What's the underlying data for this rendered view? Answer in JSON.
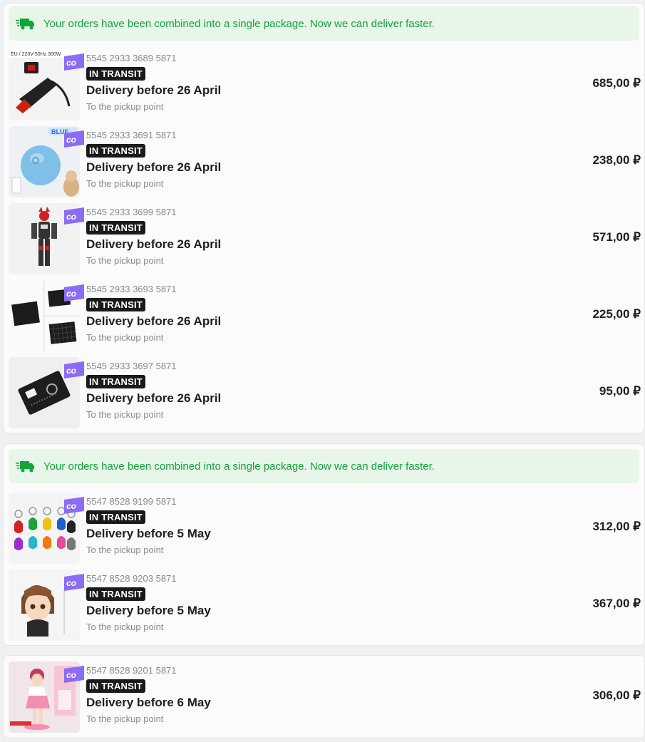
{
  "groups": [
    {
      "banner": "Your orders have been combined into a single package. Now we can deliver faster.",
      "orders": [
        {
          "number": "5545 2933 3689 5871",
          "status": "IN TRANSIT",
          "delivery": "Delivery before 26 April",
          "pickup": "To the pickup point",
          "price": "685,00 ₽",
          "image": "hot-air-gun",
          "image_text": "EU / 220V-50Hz 300W"
        },
        {
          "number": "5545 2933 3691 5871",
          "status": "IN TRANSIT",
          "delivery": "Delivery before 26 April",
          "pickup": "To the pickup point",
          "price": "238,00 ₽",
          "image": "pet-ball-toy",
          "image_text": "BLUE"
        },
        {
          "number": "5545 2933 3699 5871",
          "status": "IN TRANSIT",
          "delivery": "Delivery before 26 April",
          "pickup": "To the pickup point",
          "price": "571,00 ₽",
          "image": "robot-figure"
        },
        {
          "number": "5545 2933 3693 5871",
          "status": "IN TRANSIT",
          "delivery": "Delivery before 26 April",
          "pickup": "To the pickup point",
          "price": "225,00 ₽",
          "image": "solar-panels"
        },
        {
          "number": "5545 2933 3697 5871",
          "status": "IN TRANSIT",
          "delivery": "Delivery before 26 April",
          "pickup": "To the pickup point",
          "price": "95,00 ₽",
          "image": "multitool-card"
        }
      ]
    },
    {
      "banner": "Your orders have been combined into a single package. Now we can deliver faster.",
      "orders": [
        {
          "number": "5547 8528 9199 5871",
          "status": "IN TRANSIT",
          "delivery": "Delivery before 5 May",
          "pickup": "To the pickup point",
          "price": "312,00 ₽",
          "image": "rfid-keyfobs"
        },
        {
          "number": "5547 8528 9203 5871",
          "status": "IN TRANSIT",
          "delivery": "Delivery before 5 May",
          "pickup": "To the pickup point",
          "price": "367,00 ₽",
          "image": "anime-figure-bust"
        }
      ]
    },
    {
      "orders": [
        {
          "number": "5547 8528 9201 5871",
          "status": "IN TRANSIT",
          "delivery": "Delivery before 6 May",
          "pickup": "To the pickup point",
          "price": "306,00 ₽",
          "image": "anime-figure-pink"
        }
      ]
    }
  ],
  "tag_label": "co",
  "colors": {
    "banner_bg": "#e7f6e9",
    "banner_text": "#12a53a",
    "status_bg": "#1a1a1a",
    "tag_purple": "#8b6cf6"
  }
}
